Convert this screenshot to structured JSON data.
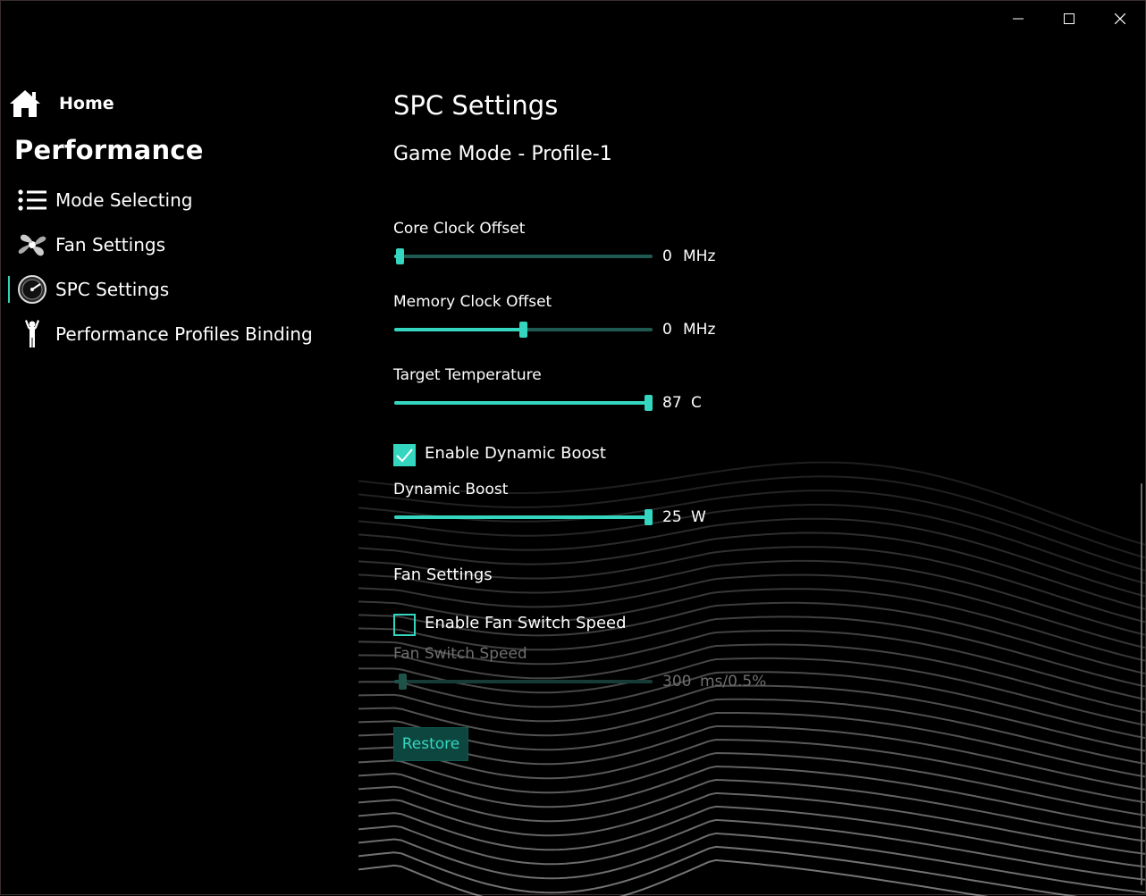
{
  "window": {
    "caption_icons": [
      "minimize-icon",
      "maximize-icon",
      "close-icon"
    ]
  },
  "nav": {
    "home_label": "Home",
    "section_title": "Performance",
    "items": [
      {
        "label": "Mode Selecting",
        "icon": "list-icon",
        "selected": false
      },
      {
        "label": "Fan Settings",
        "icon": "fan-icon",
        "selected": false
      },
      {
        "label": "SPC Settings",
        "icon": "gauge-icon",
        "selected": true
      },
      {
        "label": "Performance Profiles Binding",
        "icon": "person-icon",
        "selected": false
      }
    ]
  },
  "main": {
    "title": "SPC Settings",
    "subtitle": "Game Mode - Profile-1",
    "core_clock": {
      "label": "Core Clock Offset",
      "value": "0",
      "unit": "MHz",
      "fraction": 0.0
    },
    "memory_clock": {
      "label": "Memory Clock Offset",
      "value": "0",
      "unit": "MHz",
      "fraction": 0.5
    },
    "target_temp": {
      "label": "Target Temperature",
      "value": "87",
      "unit": "C",
      "fraction": 1.0
    },
    "dynamic_boost_toggle": {
      "label": "Enable Dynamic Boost",
      "checked": true
    },
    "dynamic_boost": {
      "label": "Dynamic Boost",
      "value": "25",
      "unit": "W",
      "fraction": 1.0
    },
    "fan_section": "Fan Settings",
    "fan_switch_toggle": {
      "label": "Enable Fan Switch Speed",
      "checked": false
    },
    "fan_switch_speed": {
      "label": "Fan Switch Speed",
      "value": "300",
      "unit": "ms/0.5%",
      "fraction": 0.0
    },
    "restore_label": "Restore"
  },
  "colors": {
    "accent": "#35d6bf",
    "track": "#1f5a52",
    "background": "#000000"
  }
}
